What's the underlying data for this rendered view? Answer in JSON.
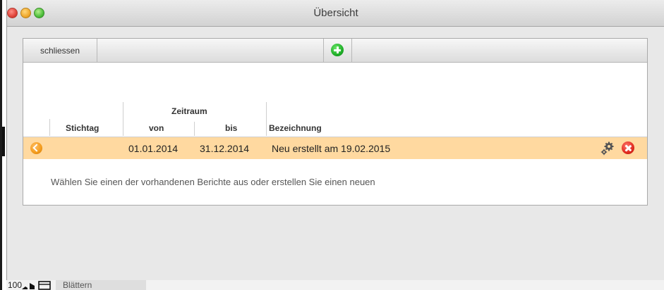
{
  "window": {
    "title": "Übersicht"
  },
  "toolbar": {
    "close_label": "schliessen"
  },
  "table": {
    "headers": {
      "stichtag": "Stichtag",
      "zeitraum": "Zeitraum",
      "von": "von",
      "bis": "bis",
      "bezeichnung": "Bezeichnung"
    },
    "rows": [
      {
        "stichtag": "",
        "von": "01.01.2014",
        "bis": "31.12.2014",
        "bezeichnung": "Neu erstellt am 19.02.2015"
      }
    ]
  },
  "hint": "Wählen Sie einen der vorhandenen Berichte aus oder erstellen Sie einen neuen",
  "statusbar": {
    "zoom": "100",
    "mode_label": "Blättern"
  },
  "colors": {
    "row_highlight": "#ffd9a0",
    "add": "#1fae28",
    "delete": "#e02a1e",
    "back": "#f39a1a"
  }
}
